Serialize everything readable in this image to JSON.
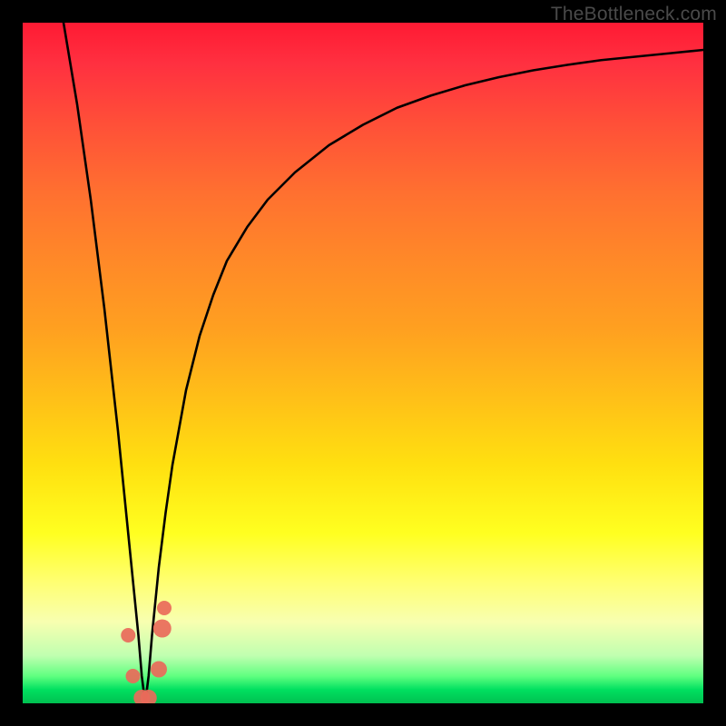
{
  "watermark": "TheBottleneck.com",
  "chart_data": {
    "type": "line",
    "title": "",
    "xlabel": "",
    "ylabel": "",
    "xlim": [
      0,
      100
    ],
    "ylim": [
      0,
      100
    ],
    "grid": false,
    "legend": false,
    "background": "red-yellow-green vertical gradient (high=red top, low=green bottom)",
    "series": [
      {
        "name": "bottleneck-curve",
        "description": "Absolute deviation from an optimal match point around x≈18; sharp V near minimum with asymptotic rise toward 100 on the right, and near-vertical rise on the left.",
        "x": [
          6,
          8,
          10,
          12,
          14,
          15,
          16,
          17,
          17.5,
          18,
          18.5,
          19,
          20,
          21,
          22,
          24,
          26,
          28,
          30,
          33,
          36,
          40,
          45,
          50,
          55,
          60,
          65,
          70,
          75,
          80,
          85,
          90,
          95,
          100
        ],
        "values": [
          100,
          88,
          74,
          58,
          40,
          30,
          20,
          10,
          4,
          0,
          4,
          10,
          20,
          28,
          35,
          46,
          54,
          60,
          65,
          70,
          74,
          78,
          82,
          85,
          87.5,
          89.3,
          90.8,
          92,
          93,
          93.8,
          94.5,
          95,
          95.5,
          96
        ]
      }
    ],
    "markers": [
      {
        "name": "point-left-upper",
        "x": 15.5,
        "y": 10,
        "r": 8,
        "color": "#e96a5a"
      },
      {
        "name": "point-left-lower",
        "x": 16.2,
        "y": 4,
        "r": 8,
        "color": "#e96a5a"
      },
      {
        "name": "point-min-a",
        "x": 17.5,
        "y": 0.8,
        "r": 9,
        "color": "#e96a5a"
      },
      {
        "name": "point-min-b",
        "x": 18.5,
        "y": 0.8,
        "r": 9,
        "color": "#e96a5a"
      },
      {
        "name": "point-right-lower",
        "x": 20.0,
        "y": 5,
        "r": 9,
        "color": "#e96a5a"
      },
      {
        "name": "point-right-upper",
        "x": 20.5,
        "y": 11,
        "r": 10,
        "color": "#e96a5a"
      },
      {
        "name": "point-right-upper2",
        "x": 20.8,
        "y": 14,
        "r": 8,
        "color": "#e96a5a"
      }
    ]
  }
}
